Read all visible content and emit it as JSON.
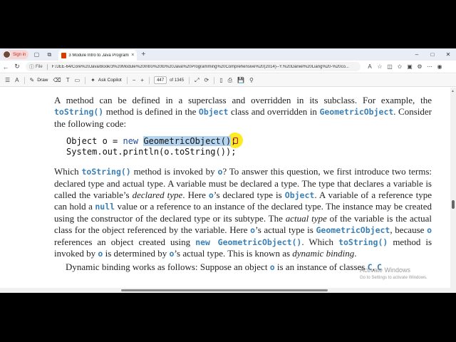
{
  "browser": {
    "profile_label": "Sign in",
    "tab_title": "3 Module Intro to Java Programming",
    "tab_close": "×",
    "new_tab": "+",
    "window_controls": [
      "–",
      "□",
      "✕"
    ]
  },
  "address_bar": {
    "file_label": "File",
    "url": "F:/JEE-64/Core%20Java/Book/3%20Module%20Intro%20to%20Java%20Programming%20Comprehensive%20(2014)--Y.%20Daniel%20Liang%20-%20co..."
  },
  "pdf_toolbar": {
    "draw_label": "Draw",
    "copilot_label": "Ask Copilot",
    "page_current": "447",
    "page_total": "of 1345"
  },
  "document": {
    "para1": {
      "t1": "A method can be defined in a superclass and overridden in its subclass. For example, the ",
      "c1": "toString()",
      "t2": " method is defined in the ",
      "c2": "Object",
      "t3": " class and overridden in ",
      "c3": "GeometricObject",
      "t4": ". Consider the following code:"
    },
    "code": {
      "line1_pre": "Object o = ",
      "line1_kw": "new",
      "line1_hl": "GeometricObject()",
      "line1_post": ";",
      "line2": "System.out.println(o.toString());"
    },
    "para2": {
      "t1": "Which ",
      "c1": "toString()",
      "t2": " method is invoked by ",
      "c2": "o",
      "t3": "? To answer this question, we first introduce two terms: declared type and actual type. A variable must be declared a type. The type that declares a variable is called the variable’s ",
      "i1": "declared type",
      "t4": ". Here ",
      "c3": "o",
      "t5": "’s declared type is ",
      "c4": "Object",
      "t6": ". A variable of a reference type can hold a ",
      "c5": "null",
      "t7": " value or a reference to an instance of the declared type. The instance may be created using the constructor of the declared type or its subtype. The ",
      "i2": "actual type",
      "t8": " of the variable is the actual class for the object referenced by the variable. Here ",
      "c6": "o",
      "t9": "’s actual type is ",
      "c7": "GeometricObject",
      "t10": ", because ",
      "c8": "o",
      "t11": " references an object created using ",
      "c9": "new GeometricObject()",
      "t12": ". Which ",
      "c10": "toString()",
      "t13": " method is invoked by ",
      "c11": "o",
      "t14": " is determined by ",
      "c12": "o",
      "t15": "’s actual type. This is known as ",
      "i3": "dynamic binding",
      "t16": "."
    },
    "para3": {
      "t1": "Dynamic binding works as follows: Suppose an object ",
      "c1": "o",
      "t2": " is an instance of classes ",
      "c2": "C",
      "t3": ", ",
      "c3": "C"
    }
  },
  "watermark": {
    "line1": "Activate Windows",
    "line2": "Go to Settings to activate Windows."
  }
}
